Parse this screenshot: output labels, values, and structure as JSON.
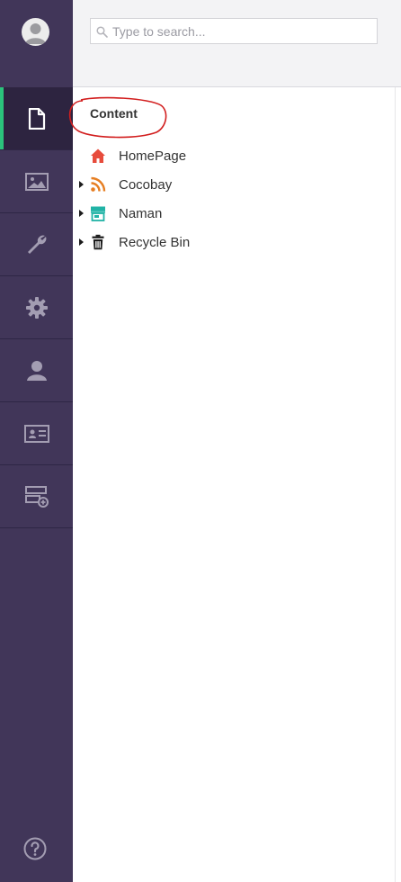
{
  "search": {
    "placeholder": "Type to search..."
  },
  "tree": {
    "title": "Content",
    "items": [
      {
        "label": "HomePage",
        "icon": "home-icon",
        "color": "#e74c3c",
        "has_children": false
      },
      {
        "label": "Cocobay",
        "icon": "rss-icon",
        "color": "#e67e22",
        "has_children": true
      },
      {
        "label": "Naman",
        "icon": "store-icon",
        "color": "#21b3a6",
        "has_children": true
      },
      {
        "label": "Recycle Bin",
        "icon": "trash-icon",
        "color": "#1b1b1b",
        "has_children": true
      }
    ]
  },
  "sidebar": {
    "sections": [
      {
        "name": "content",
        "icon": "document-icon",
        "active": true
      },
      {
        "name": "media",
        "icon": "image-icon",
        "active": false
      },
      {
        "name": "settings",
        "icon": "wrench-icon",
        "active": false
      },
      {
        "name": "developer",
        "icon": "gear-icon",
        "active": false
      },
      {
        "name": "users",
        "icon": "user-icon",
        "active": false
      },
      {
        "name": "members",
        "icon": "id-card-icon",
        "active": false
      },
      {
        "name": "forms",
        "icon": "form-add-icon",
        "active": false
      }
    ],
    "help_icon": "help-icon"
  },
  "colors": {
    "sidebar_bg": "#413659",
    "active_indicator": "#2bc37c",
    "annotation": "#d21e1e"
  }
}
